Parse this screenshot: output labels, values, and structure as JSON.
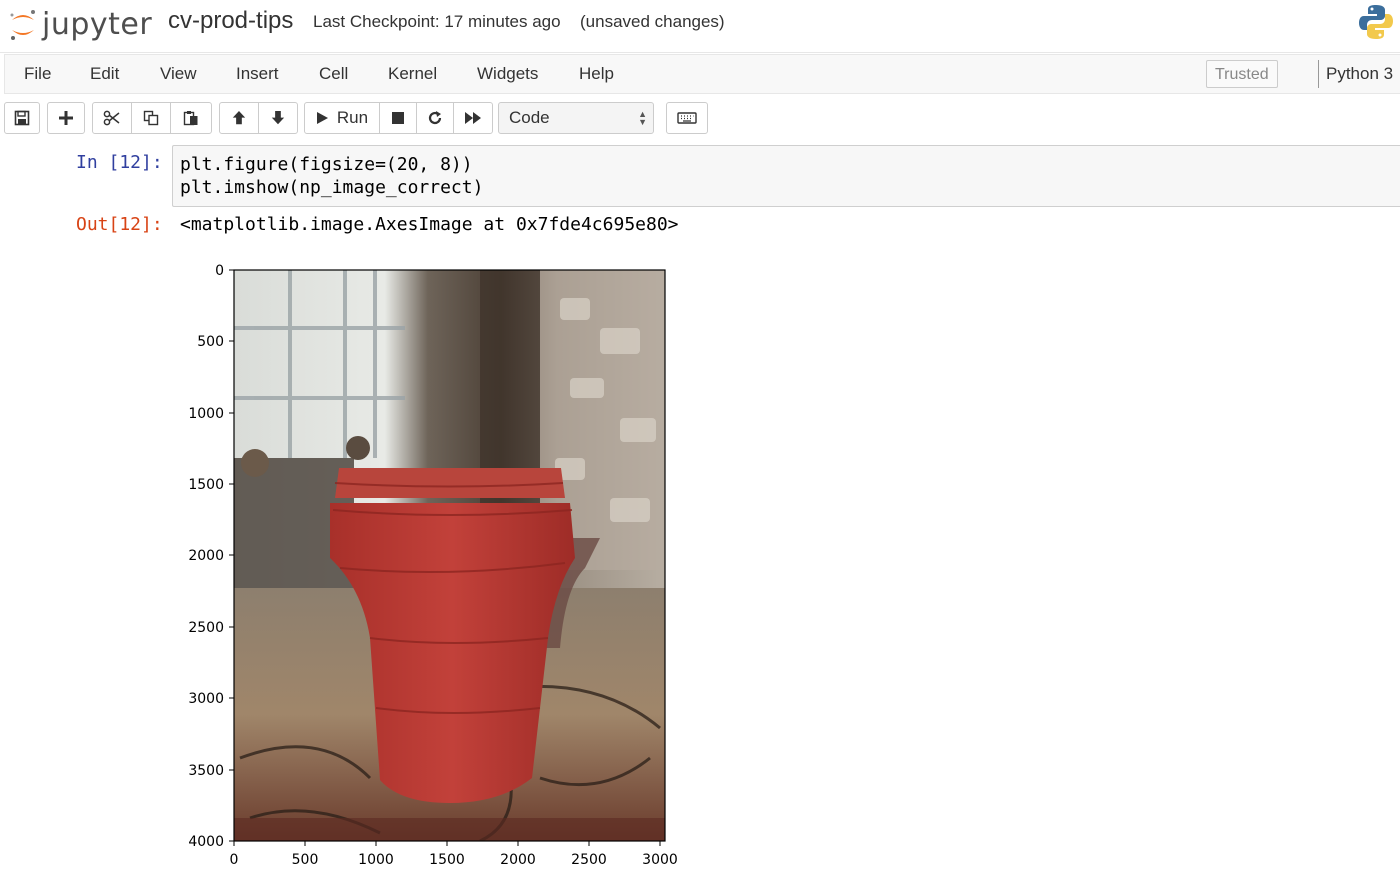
{
  "header": {
    "logo_text": "jupyter",
    "notebook_name": "cv-prod-tips",
    "checkpoint": "Last Checkpoint: 17 minutes ago",
    "status": "(unsaved changes)"
  },
  "menu": {
    "items": [
      "File",
      "Edit",
      "View",
      "Insert",
      "Cell",
      "Kernel",
      "Widgets",
      "Help"
    ],
    "trusted": "Trusted",
    "kernel": "Python 3"
  },
  "toolbar": {
    "run_label": "Run",
    "cell_type": "Code"
  },
  "cell": {
    "in_prompt": "In [12]:",
    "code_lines": [
      "plt.figure(figsize=(20, 8))",
      "plt.imshow(np_image_correct)"
    ],
    "out_prompt": "Out[12]:",
    "out_text": "<matplotlib.image.AxesImage at 0x7fde4c695e80>"
  },
  "figure": {
    "y_ticks": [
      "0",
      "500",
      "1000",
      "1500",
      "2000",
      "2500",
      "3000",
      "3500",
      "4000"
    ],
    "x_ticks": [
      "0",
      "500",
      "1000",
      "1500",
      "2000",
      "2500",
      "3000"
    ],
    "cup_color": "#b83a32"
  }
}
